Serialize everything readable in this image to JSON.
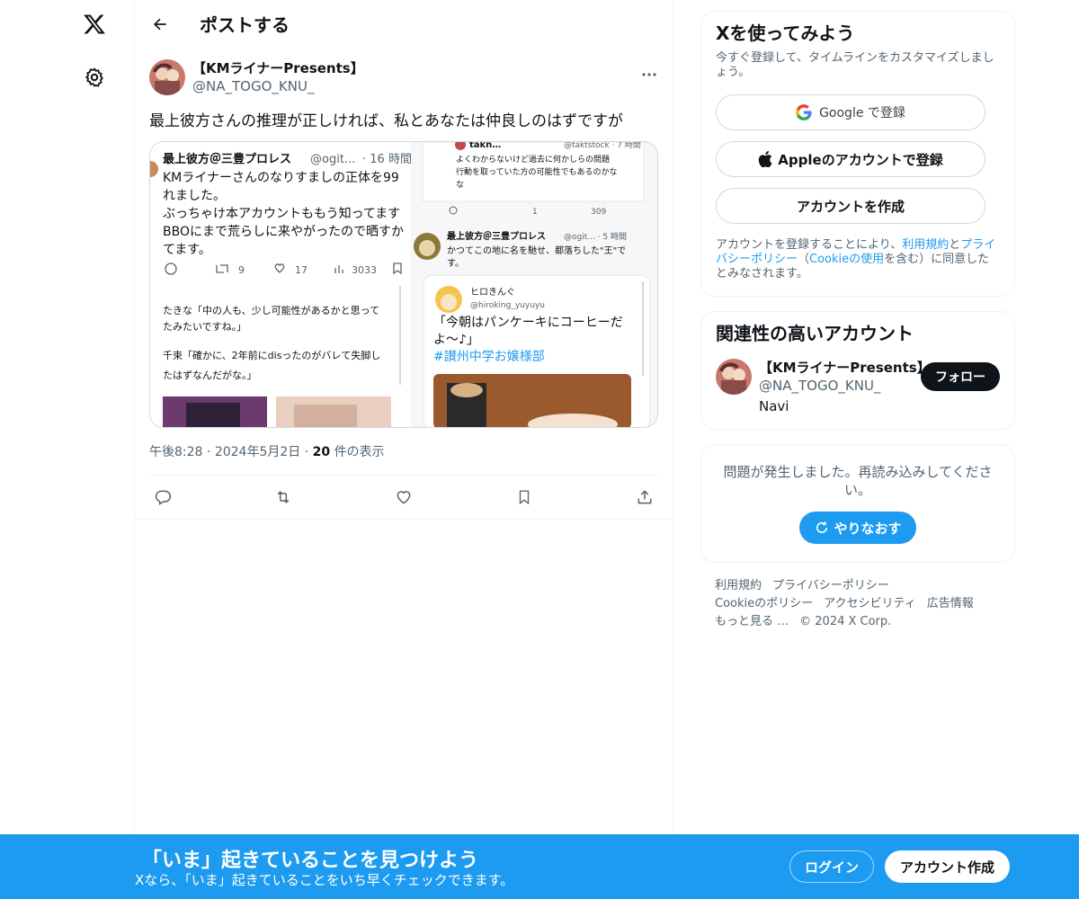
{
  "nav": {
    "logo_icon": "x-logo-icon",
    "settings_icon": "gear-icon"
  },
  "header": {
    "title": "ポストする",
    "back_icon": "arrow-left-icon"
  },
  "tweet": {
    "display_name": "【KMライナーPresents】",
    "handle": "@NA_TOGO_KNU_",
    "text": "最上彼方さんの推理が正しければ、私とあなたは仲良しのはずですが",
    "time": "午後8:28",
    "date": "2024年5月2日",
    "views": "20",
    "views_label": "件の表示",
    "media": {
      "left_name": "最上彼方＠三豊プロレス",
      "left_handle": "@ogit...",
      "left_time": "· 16 時間",
      "left_lines": [
        "KMライナーさんのなりすましの正体を99",
        "れました。",
        "ぶっちゃけ本アカウントももう知ってます",
        "BBOにまで荒らしに来やがったので晒すか",
        "てます。"
      ],
      "left_stats": {
        "retweets": "9",
        "likes": "17",
        "views": "3033"
      },
      "left_reply1": "たきな「中の人も、少し可能性があるかと思って",
      "left_reply2": "たみたいですね。」",
      "left_reply3": "千束「確かに、2年前にdisったのがバレて失脚し",
      "left_reply4": "たはずなんだがな。」",
      "right_top_name": "takn…",
      "right_top_handle": "@taktstock · 7 時間",
      "right_top_lines": [
        "よくわからないけど過去に何かしらの問題",
        "行動を取っていた方の可能性でもあるのかな"
      ],
      "right_top_stats": {
        "likes": "1",
        "views": "309"
      },
      "right_mid_name": "最上彼方＠三豊プロレス",
      "right_mid_handle": "@ogit... · 5 時間",
      "right_mid_lines": [
        "かつてこの地に名を馳せ、都落ちした\"王\"で",
        "す。"
      ],
      "inner_name": "ヒロきんぐ",
      "inner_handle": "@hiroking_yuyuyu",
      "inner_lines": [
        "「今朝はパンケーキにコーヒーだ",
        "よ〜♪」"
      ],
      "inner_tag": "#讃州中学お嬢様部"
    }
  },
  "right": {
    "signup": {
      "title": "Xを使ってみよう",
      "subtitle": "今すぐ登録して、タイムラインをカスタマイズしましょう。",
      "google_label": "Google で登録",
      "apple_label": "Appleのアカウントで登録",
      "create_label": "アカウントを作成",
      "legal_pre": "アカウントを登録することにより、",
      "legal_terms": "利用規約",
      "legal_and": "と",
      "legal_privacy": "プライバシーポリシー",
      "legal_mid": "（",
      "legal_cookie": "Cookieの使用",
      "legal_post": "を含む）に同意したとみなされます。"
    },
    "related": {
      "title": "関連性の高いアカウント",
      "name": "【KMライナーPresents】",
      "handle": "@NA_TOGO_KNU_",
      "bio": "Navi",
      "follow_label": "フォロー"
    },
    "error": {
      "text": "問題が発生しました。再読み込みしてください。",
      "retry_label": "やりなおす"
    },
    "footer": {
      "links": [
        "利用規約",
        "プライバシーポリシー",
        "Cookieのポリシー",
        "アクセシビリティ",
        "広告情報",
        "もっと見る …"
      ],
      "copyright": "© 2024 X Corp."
    }
  },
  "bottombar": {
    "title": "「いま」起きていることを見つけよう",
    "subtitle": "Xなら、「いま」起きていることをいち早くチェックできます。",
    "login_label": "ログイン",
    "signup_label": "アカウント作成"
  },
  "colors": {
    "accent": "#1d9bf0",
    "text": "#0f1419",
    "muted": "#536471",
    "border": "#eff3f4"
  }
}
